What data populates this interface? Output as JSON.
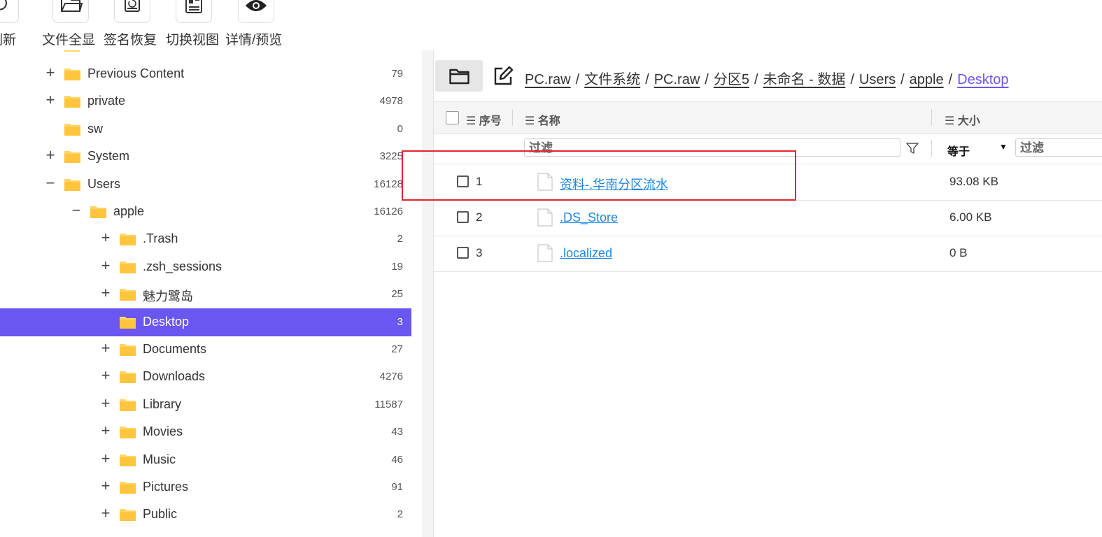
{
  "toolbar": {
    "buttons": [
      {
        "label": "刷新",
        "icon": "refresh-icon"
      },
      {
        "label": "文件全显",
        "icon": "folder-open-icon"
      },
      {
        "label": "签名恢复",
        "icon": "signature-restore-icon"
      },
      {
        "label": "切换视图",
        "icon": "switch-view-icon"
      },
      {
        "label": "详情/预览",
        "icon": "eye-icon"
      }
    ]
  },
  "tree": {
    "items": [
      {
        "name": "Previous Content",
        "count": "79",
        "expander": "+"
      },
      {
        "name": "private",
        "count": "4978",
        "expander": "+"
      },
      {
        "name": "sw",
        "count": "0",
        "expander": ""
      },
      {
        "name": "System",
        "count": "3225",
        "expander": "+"
      },
      {
        "name": "Users",
        "count": "16128",
        "expander": "−"
      },
      {
        "name": "apple",
        "count": "16126",
        "expander": "−"
      },
      {
        "name": ".Trash",
        "count": "2",
        "expander": "+"
      },
      {
        "name": ".zsh_sessions",
        "count": "19",
        "expander": "+"
      },
      {
        "name": "魅力鹭岛",
        "count": "25",
        "expander": "+"
      },
      {
        "name": "Desktop",
        "count": "3",
        "expander": "",
        "selected": true
      },
      {
        "name": "Documents",
        "count": "27",
        "expander": "+"
      },
      {
        "name": "Downloads",
        "count": "4276",
        "expander": "+"
      },
      {
        "name": "Library",
        "count": "11587",
        "expander": "+"
      },
      {
        "name": "Movies",
        "count": "43",
        "expander": "+"
      },
      {
        "name": "Music",
        "count": "46",
        "expander": "+"
      },
      {
        "name": "Pictures",
        "count": "91",
        "expander": "+"
      },
      {
        "name": "Public",
        "count": "2",
        "expander": "+"
      }
    ]
  },
  "breadcrumb": {
    "segments": [
      "PC.raw",
      "文件系统",
      "PC.raw",
      "分区5",
      "未命名 - 数据",
      "Users",
      "apple"
    ],
    "current": "Desktop",
    "separator": "/"
  },
  "grid": {
    "headers": {
      "index": "序号",
      "name": "名称",
      "size": "大小"
    },
    "filter": {
      "name_placeholder": "过滤",
      "size_operator": "等于",
      "size_placeholder": "过滤"
    },
    "rows": [
      {
        "index": "1",
        "name": "资料-.华南分区流水",
        "size": "93.08 KB"
      },
      {
        "index": "2",
        "name": ".DS_Store",
        "size": "6.00 KB"
      },
      {
        "index": "3",
        "name": ".localized",
        "size": "0 B"
      }
    ]
  },
  "colors": {
    "accent": "#6a56f0",
    "link": "#1e88e5",
    "highlight_box": "#e0262f",
    "folder": "#ffd666"
  }
}
